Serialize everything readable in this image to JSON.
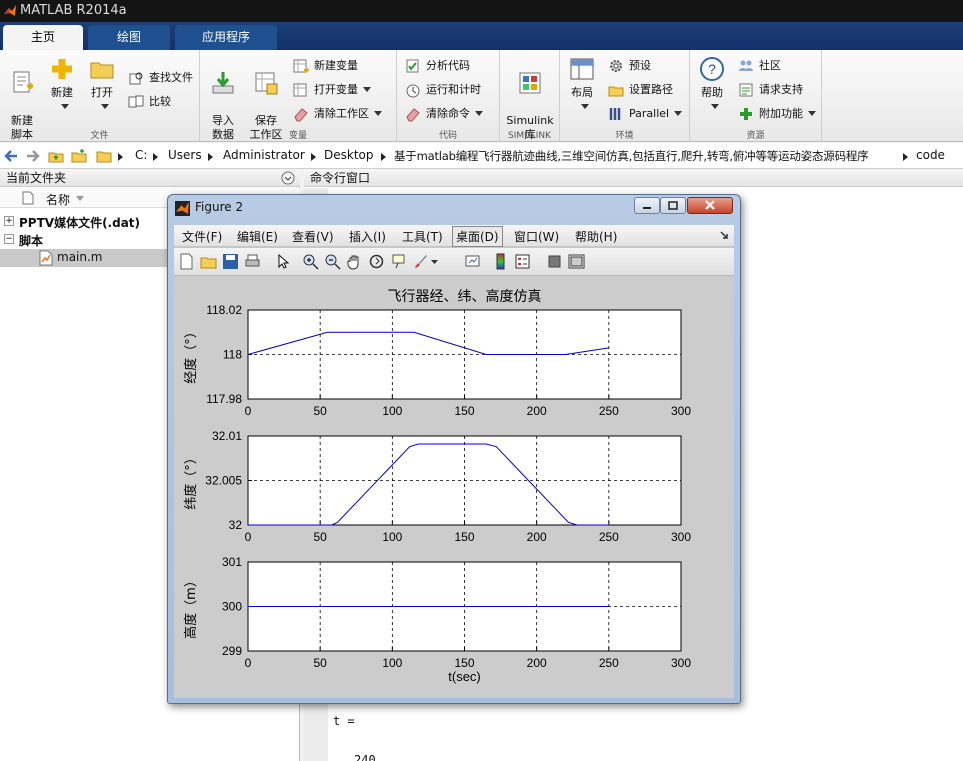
{
  "app": {
    "title": "MATLAB R2014a"
  },
  "tabs": [
    {
      "label": "主页"
    },
    {
      "label": "绘图"
    },
    {
      "label": "应用程序"
    }
  ],
  "ribbon": {
    "file_group": {
      "label": "文件",
      "new_script": "新建\n脚本",
      "new": "新建",
      "open": "打开",
      "find_files": "查找文件",
      "compare": "比较"
    },
    "variable_group": {
      "label": "变量",
      "import_data": "导入\n数据",
      "save_workspace": "保存\n工作区",
      "new_variable": "新建变量",
      "open_variable": "打开变量",
      "clear_workspace": "清除工作区"
    },
    "code_group": {
      "label": "代码",
      "analyze_code": "分析代码",
      "run_and_time": "运行和计时",
      "clear_commands": "清除命令"
    },
    "simulink_group": {
      "label": "SIMULINK",
      "simulink_library": "Simulink\n库"
    },
    "environment_group": {
      "label": "环境",
      "layout": "布局",
      "preferences": "预设",
      "set_path": "设置路径",
      "parallel": "Parallel"
    },
    "resources_group": {
      "label": "资源",
      "help": "帮助",
      "community": "社区",
      "request_support": "请求支持",
      "add_ons": "附加功能"
    }
  },
  "address": {
    "crumbs": [
      "C:",
      "Users",
      "Administrator",
      "Desktop",
      "基于matlab编程飞行器航迹曲线,三维空间仿真,包括直行,爬升,转弯,俯冲等等运动姿态源码程序",
      "code"
    ]
  },
  "current_folder": {
    "title": "当前文件夹",
    "column": "名称",
    "items": [
      {
        "name": "PPTV媒体文件(.dat)",
        "type": "folder"
      },
      {
        "name": "脚本",
        "type": "group"
      },
      {
        "name": "main.m",
        "type": "file"
      }
    ]
  },
  "command_window": {
    "title": "命令行窗口",
    "lines": [
      "t =",
      "240"
    ]
  },
  "figure": {
    "title": "Figure 2",
    "menu": [
      "文件(F)",
      "编辑(E)",
      "查看(V)",
      "插入(I)",
      "工具(T)",
      "桌面(D)",
      "窗口(W)",
      "帮助(H)"
    ],
    "menu_selected": "桌面(D)"
  },
  "chart_data": [
    {
      "type": "line",
      "title": "飞行器经、纬、高度仿真",
      "ylabel": "经度（°）",
      "xlabel": "",
      "xlim": [
        0,
        300
      ],
      "ylim": [
        117.98,
        118.02
      ],
      "xticks": [
        "0",
        "50",
        "100",
        "150",
        "200",
        "250",
        "300"
      ],
      "yticks": [
        "117.98",
        "118",
        "118.02"
      ],
      "grid": true,
      "series": [
        {
          "x": [
            0,
            55,
            115,
            165,
            220,
            250
          ],
          "y": [
            118.0,
            118.01,
            118.01,
            118.0,
            118.0,
            118.003
          ]
        }
      ]
    },
    {
      "type": "line",
      "title": "",
      "ylabel": "纬度（°）",
      "xlabel": "",
      "xlim": [
        0,
        300
      ],
      "ylim": [
        32,
        32.01
      ],
      "xticks": [
        "0",
        "50",
        "100",
        "150",
        "200",
        "250",
        "300"
      ],
      "yticks": [
        "32",
        "32.005",
        "32.01"
      ],
      "grid": true,
      "series": [
        {
          "x": [
            0,
            58,
            62,
            112,
            118,
            165,
            172,
            222,
            228,
            250
          ],
          "y": [
            32,
            32,
            32.0003,
            32.0088,
            32.0091,
            32.0091,
            32.0088,
            32.0003,
            32,
            32
          ]
        }
      ]
    },
    {
      "type": "line",
      "title": "",
      "ylabel": "高度（m）",
      "xlabel": "t(sec)",
      "xlim": [
        0,
        300
      ],
      "ylim": [
        299,
        301
      ],
      "xticks": [
        "0",
        "50",
        "100",
        "150",
        "200",
        "250",
        "300"
      ],
      "yticks": [
        "299",
        "300",
        "301"
      ],
      "grid": true,
      "series": [
        {
          "x": [
            0,
            250
          ],
          "y": [
            300,
            300
          ]
        }
      ]
    }
  ],
  "colors": {
    "line": "#0000cc",
    "tabbar": "#1a3a70",
    "figure_bg": "#cccccc"
  }
}
